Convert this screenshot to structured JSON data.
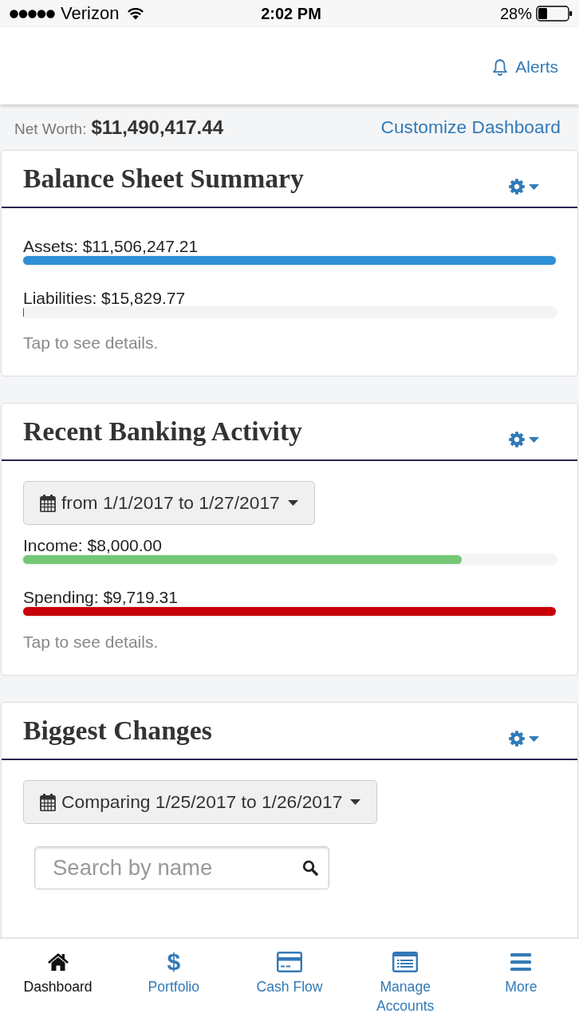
{
  "status_bar": {
    "carrier": "Verizon",
    "time": "2:02 PM",
    "battery": "28%"
  },
  "header": {
    "alerts_link": "Alerts"
  },
  "net_worth": {
    "label": "Net Worth:",
    "value": "$11,490,417.44",
    "customize_link": "Customize Dashboard"
  },
  "cards": [
    {
      "title": "Balance Sheet Summary",
      "meters": [
        {
          "label": "Assets: $11,506,247.21",
          "level": 1.0,
          "color": "#2d8fd6"
        },
        {
          "label": "Liabilities: $15,829.77",
          "level": 0.0014,
          "color": "#3c4f80"
        }
      ],
      "hint": "Tap to see details."
    },
    {
      "title": "Recent Banking Activity",
      "date_range": "from 1/1/2017 to 1/27/2017",
      "meters": [
        {
          "label": "Income: $8,000.00",
          "level": 0.823,
          "color": "#74c776"
        },
        {
          "label": "Spending: $9,719.31",
          "level": 1.0,
          "color": "#c8000a"
        }
      ],
      "hint": "Tap to see details."
    },
    {
      "title": "Biggest Changes",
      "date_range": "Comparing 1/25/2017 to 1/26/2017",
      "search": {
        "placeholder": "Search by name"
      }
    }
  ],
  "tab_bar": [
    {
      "label": "Dashboard",
      "selected": true
    },
    {
      "label": "Portfolio",
      "icon": "$",
      "selected": false
    },
    {
      "label": "Cash Flow",
      "selected": false
    },
    {
      "label": "Manage Accounts",
      "selected": false
    },
    {
      "label": "More",
      "selected": false
    }
  ]
}
